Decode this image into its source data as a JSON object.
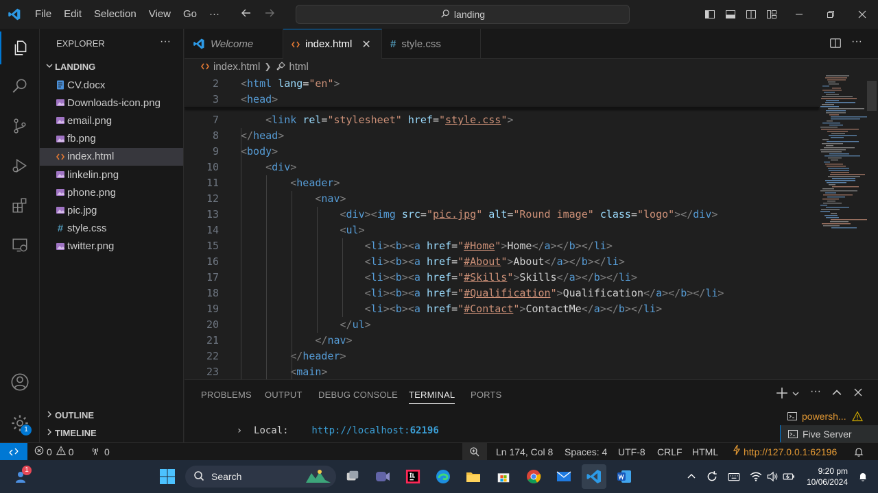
{
  "titlebar": {
    "menu": [
      "File",
      "Edit",
      "Selection",
      "View",
      "Go"
    ],
    "more": "···",
    "search": "landing"
  },
  "explorer": {
    "title": "EXPLORER",
    "more": "···",
    "folder": "LANDING",
    "files": [
      {
        "name": "CV.docx",
        "icon": "word-doc-icon"
      },
      {
        "name": "Downloads-icon.png",
        "icon": "image-icon"
      },
      {
        "name": "email.png",
        "icon": "image-icon"
      },
      {
        "name": "fb.png",
        "icon": "image-icon"
      },
      {
        "name": "index.html",
        "icon": "html-icon",
        "selected": true
      },
      {
        "name": "linkelin.png",
        "icon": "image-icon"
      },
      {
        "name": "phone.png",
        "icon": "image-icon"
      },
      {
        "name": "pic.jpg",
        "icon": "image-icon"
      },
      {
        "name": "style.css",
        "icon": "css-icon"
      },
      {
        "name": "twitter.png",
        "icon": "image-icon"
      }
    ],
    "outline": "OUTLINE",
    "timeline": "TIMELINE"
  },
  "tabs": [
    {
      "label": "Welcome",
      "active": false
    },
    {
      "label": "index.html",
      "active": true
    },
    {
      "label": "style.css",
      "active": false
    }
  ],
  "breadcrumb": {
    "file": "index.html",
    "element": "html"
  },
  "editor": {
    "lines": [
      {
        "n": "2",
        "code": "<html lang=\"en\">"
      },
      {
        "n": "3",
        "code": "<head>"
      },
      {
        "n": "7",
        "code": "    <link rel=\"stylesheet\" href=\"style.css\">"
      },
      {
        "n": "8",
        "code": "</head>"
      },
      {
        "n": "9",
        "code": "<body>"
      },
      {
        "n": "10",
        "code": "    <div>"
      },
      {
        "n": "11",
        "code": "        <header>"
      },
      {
        "n": "12",
        "code": "            <nav>"
      },
      {
        "n": "13",
        "code": "                <div><img src=\"pic.jpg\" alt=\"Round image\" class=\"logo\"></div>"
      },
      {
        "n": "14",
        "code": "                <ul>"
      },
      {
        "n": "15",
        "code": "                    <li><b><a href=\"#Home\">Home</a></b></li>"
      },
      {
        "n": "16",
        "code": "                    <li><b><a href=\"#About\">About</a></b></li>"
      },
      {
        "n": "17",
        "code": "                    <li><b><a href=\"#Skills\">Skills</a></b></li>"
      },
      {
        "n": "18",
        "code": "                    <li><b><a href=\"#Qualification\">Qualification</a></b></li>"
      },
      {
        "n": "19",
        "code": "                    <li><b><a href=\"#Contact\">ContactMe</a></b></li>"
      },
      {
        "n": "20",
        "code": "                </ul>"
      },
      {
        "n": "21",
        "code": "            </nav>"
      },
      {
        "n": "22",
        "code": "        </header>"
      },
      {
        "n": "23",
        "code": "        <main>"
      }
    ]
  },
  "panel": {
    "tabs": [
      "PROBLEMS",
      "OUTPUT",
      "DEBUG CONSOLE",
      "TERMINAL",
      "PORTS"
    ],
    "active_tab": "TERMINAL",
    "terminal_label": "Local:",
    "terminal_url_prefix": "http://localhost:",
    "terminal_port": "62196",
    "terminals": [
      "powersh...",
      "Five Server"
    ]
  },
  "statusbar": {
    "errors": "0",
    "warnings": "0",
    "ports": "0",
    "position": "Ln 174, Col 8",
    "spaces": "Spaces: 4",
    "encoding": "UTF-8",
    "eol": "CRLF",
    "language": "HTML",
    "server": "http://127.0.0.1:62196"
  },
  "taskbar": {
    "search": "Search",
    "time": "9:20 pm",
    "date": "10/06/2024",
    "notif_badge": "1"
  },
  "colors": {
    "accent": "#0078d4",
    "editor_bg": "#1f1f1f",
    "sidebar_bg": "#181818",
    "taskbar_bg": "#202a38"
  }
}
